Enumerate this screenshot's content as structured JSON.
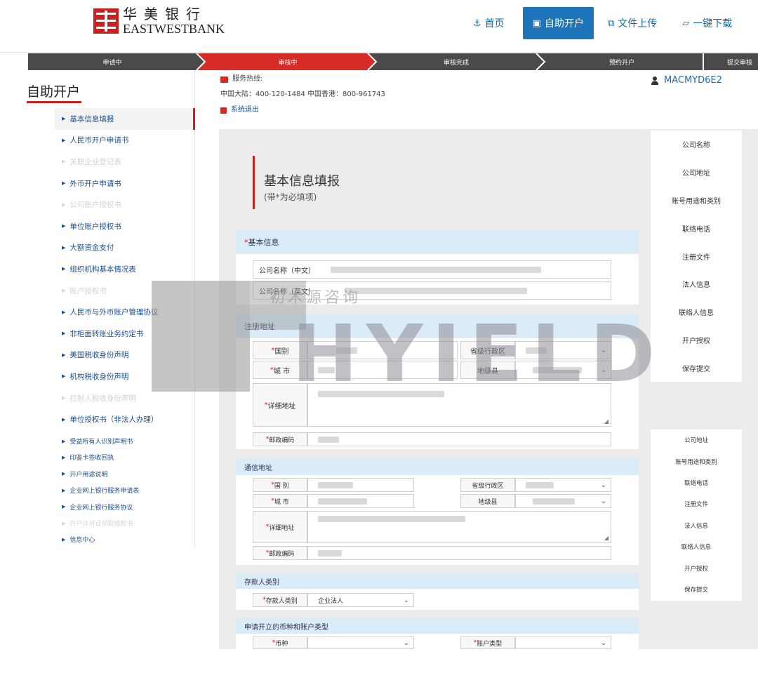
{
  "header": {
    "logo_cn": "华美银行",
    "logo_en": "EASTWESTBANK",
    "nav": [
      {
        "label": "首页",
        "icon": "anchor-icon"
      },
      {
        "label": "自助开户",
        "icon": "id-card-icon"
      },
      {
        "label": "文件上传",
        "icon": "copy-icon"
      },
      {
        "label": "一键下载",
        "icon": "folder-open-icon"
      }
    ]
  },
  "steps": [
    "申请中",
    "审核中",
    "审核完成",
    "预约开户",
    "提交审核"
  ],
  "sidebar": {
    "title": "自助开户",
    "items": [
      {
        "label": "基本信息填报",
        "state": "active"
      },
      {
        "label": "人民币开户申请书",
        "state": "normal"
      },
      {
        "label": "关联企业登记表",
        "state": "disabled"
      },
      {
        "label": "外币开户申请书",
        "state": "normal"
      },
      {
        "label": "公司账户授权书",
        "state": "disabled"
      },
      {
        "label": "单位账户授权书",
        "state": "normal"
      },
      {
        "label": "大额资金支付",
        "state": "normal"
      },
      {
        "label": "组织机构基本情况表",
        "state": "normal"
      },
      {
        "label": "账户授权书",
        "state": "disabled"
      },
      {
        "label": "人民币与外币账户管理协议",
        "state": "normal"
      },
      {
        "label": "非柜面转账业务约定书",
        "state": "normal"
      },
      {
        "label": "美国税收身份声明",
        "state": "normal"
      },
      {
        "label": "机构税收身份声明",
        "state": "normal"
      },
      {
        "label": "控制人税收身份声明",
        "state": "disabled"
      },
      {
        "label": "单位授权书（非法人办理）",
        "state": "normal"
      }
    ],
    "small_items": [
      {
        "label": "受益所有人识别声明书",
        "state": "normal"
      },
      {
        "label": "印鉴卡签收回执",
        "state": "normal"
      },
      {
        "label": "开户用途说明",
        "state": "normal"
      },
      {
        "label": "企业网上银行服务申请表",
        "state": "normal"
      },
      {
        "label": "企业网上银行服务协议",
        "state": "normal"
      },
      {
        "label": "开户许可证领取授权书",
        "state": "disabled"
      },
      {
        "label": "信息中心",
        "state": "normal"
      }
    ]
  },
  "service": {
    "hotline_label": "服务热线:",
    "hotline_numbers": "中国大陆：400-120-1484 中国香港：800-961743",
    "logout": "系统退出"
  },
  "user": {
    "account": "MACMYD6E2"
  },
  "form": {
    "title": "基本信息填报",
    "subtitle": "(带*为必填项)",
    "basic": {
      "heading": "基本信息",
      "name_cn_label": "公司名称（中文）",
      "name_en_label": "公司名称（英文）"
    },
    "reg_addr": {
      "heading": "注册地址",
      "country": "国别",
      "province": "省级行政区",
      "city": "城 市",
      "county": "地级县",
      "detail": "详细地址",
      "postcode": "邮政编码"
    },
    "mail_addr": {
      "heading": "通信地址",
      "country": "国 别",
      "province": "省级行政区",
      "city": "城 市",
      "county": "地级县",
      "detail": "详细地址",
      "postcode": "邮政编码"
    },
    "depositor": {
      "heading": "存款人类别",
      "label": "存款人类别",
      "value": "企业法人"
    },
    "currency": {
      "heading": "申请开立的币种和账户类型",
      "currency_label": "币种",
      "account_label": "账户类型"
    }
  },
  "right_nav_1": [
    "公司名称",
    "公司地址",
    "账号用途和类别",
    "联络电话",
    "注册文件",
    "法人信息",
    "联络人信息",
    "开户授权",
    "保存提交"
  ],
  "right_nav_2": [
    "公司地址",
    "账号用途和类别",
    "联络电话",
    "注册文件",
    "法人信息",
    "联络人信息",
    "开户授权",
    "保存提交"
  ],
  "watermark": {
    "text": "HYIELD",
    "cn": "初木源咨询"
  }
}
